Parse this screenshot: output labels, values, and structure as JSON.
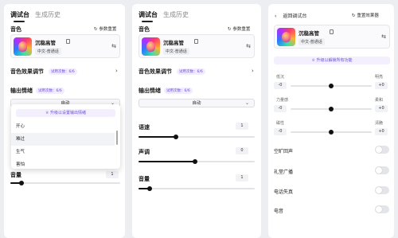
{
  "panel1": {
    "tab_active": "调试台",
    "tab_inactive": "生成历史",
    "reset_label": "参数重置",
    "voice_section": "音色",
    "voice_name": "沉稳高管",
    "voice_lang": "中文-普通话",
    "effect_label": "音色效果调节",
    "effect_badge": "试用次数：6/6",
    "emotion_label": "输出情绪",
    "emotion_badge": "试用次数：6/6",
    "emotion_select": "自动",
    "upgrade_label": "升级以设置输出情绪",
    "dropdown_options": [
      "开心",
      "难过",
      "生气",
      "害怕"
    ],
    "dropdown_selected": "难过",
    "volume_label": "音量",
    "volume_value": "1"
  },
  "panel2": {
    "tab_active": "调试台",
    "tab_inactive": "生成历史",
    "reset_label": "参数重置",
    "voice_section": "音色",
    "voice_name": "沉稳高管",
    "voice_lang": "中文-普通话",
    "effect_label": "音色效果调节",
    "effect_badge": "试用次数：6/6",
    "emotion_label": "输出情绪",
    "emotion_badge": "试用次数：6/6",
    "emotion_select": "自动",
    "speed_label": "语速",
    "speed_value": "1",
    "pitch_label": "声调",
    "pitch_value": "0",
    "volume_label": "音量",
    "volume_value": "1"
  },
  "panel3": {
    "back_label": "返回调试台",
    "reset_label": "重置效果器",
    "voice_name": "沉稳高管",
    "voice_lang": "中文-普通话",
    "upgrade_label": "升级以解锁所有功能",
    "sliders": [
      {
        "left": "低沉",
        "right": "明亮",
        "min": "-0",
        "max": "+0"
      },
      {
        "left": "力量感",
        "right": "柔和",
        "min": "-0",
        "max": "+0"
      },
      {
        "left": "磁性",
        "right": "清脆",
        "min": "-0",
        "max": "+0"
      }
    ],
    "toggles": [
      "空旷回声",
      "礼堂广播",
      "电话失真",
      "电音"
    ]
  }
}
